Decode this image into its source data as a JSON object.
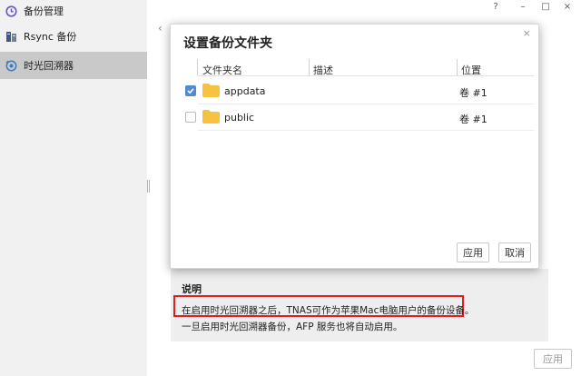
{
  "window": {
    "help_label": "?",
    "minimize_label": "–",
    "maximize_label": "□",
    "close_label": "×"
  },
  "sidebar": {
    "items": [
      {
        "label": "备份管理",
        "icon": "clock-icon"
      },
      {
        "label": "Rsync 备份",
        "icon": "server-icon"
      },
      {
        "label": "时光回溯器",
        "icon": "time-machine-icon",
        "active": true
      }
    ]
  },
  "main": {
    "back_label": "‹"
  },
  "dialog": {
    "title": "设置备份文件夹",
    "close_label": "×",
    "columns": [
      "文件夹名",
      "描述",
      "位置"
    ],
    "rows": [
      {
        "name": "appdata",
        "description": "",
        "location": "卷 #1",
        "checked": true
      },
      {
        "name": "public",
        "description": "",
        "location": "卷 #1",
        "checked": false
      }
    ],
    "apply_label": "应用",
    "cancel_label": "取消"
  },
  "explain": {
    "title": "说明",
    "line1": "在启用时光回溯器之后，TNAS可作为苹果Mac电脑用户的备份设备。",
    "line2": "一旦启用时光回溯器备份，AFP 服务也将自动启用。"
  },
  "footer": {
    "apply_label": "应用"
  },
  "colors": {
    "accent": "#4e8ad6",
    "highlight": "#e11d1d",
    "folder": "#f5c242"
  }
}
